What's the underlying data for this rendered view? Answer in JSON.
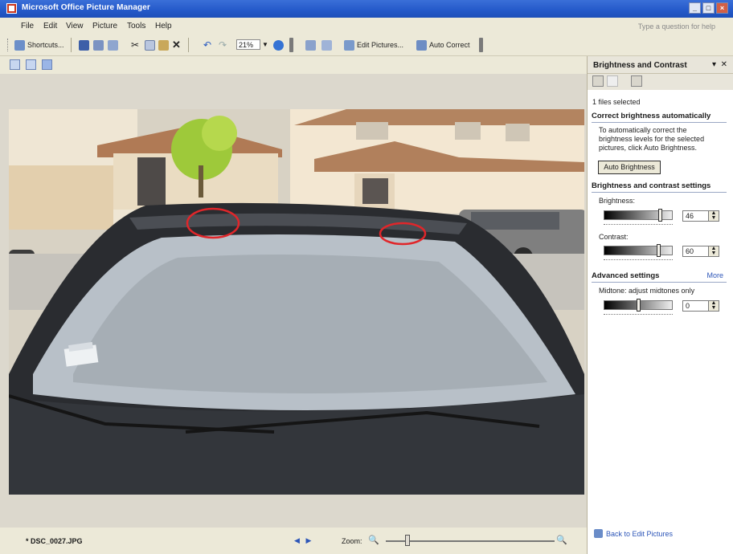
{
  "window": {
    "title": "Microsoft Office Picture Manager",
    "buttons": [
      "_",
      "□",
      "×"
    ]
  },
  "menu": {
    "items": [
      "File",
      "Edit",
      "View",
      "Picture",
      "Tools",
      "Help"
    ],
    "ask": "Type a question for help"
  },
  "toolbar": {
    "shortcuts": "Shortcuts...",
    "zoom": "21%",
    "edit_pictures": "Edit Pictures...",
    "auto_correct": "Auto Correct"
  },
  "status": {
    "filename": "DSC_0027.JPG",
    "zoom_label": "Zoom:",
    "zoom_level": 0.13
  },
  "pane": {
    "title": "Brightness and Contrast",
    "files_selected": "1 files selected",
    "section_auto": "Correct brightness automatically",
    "auto_desc": "To automatically correct the brightness levels for the selected pictures, click Auto Brightness.",
    "auto_button": "Auto Brightness",
    "section_settings": "Brightness and contrast settings",
    "brightness_label": "Brightness:",
    "brightness_value": "46",
    "contrast_label": "Contrast:",
    "contrast_value": "60",
    "section_advanced": "Advanced settings",
    "more": "More",
    "midtone_label": "Midtone: adjust midtones only",
    "midtone_value": "0",
    "back": "Back to Edit Pictures"
  },
  "colors": {
    "titlebar": "#2459c9",
    "link": "#2c55b8",
    "annotation": "#e0262a"
  }
}
